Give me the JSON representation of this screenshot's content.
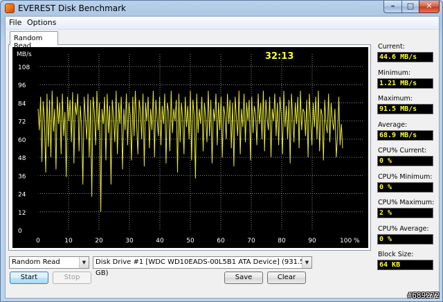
{
  "window": {
    "title": "EVEREST Disk Benchmark",
    "min_glyph": "–",
    "max_glyph": "□",
    "close_glyph": "✕"
  },
  "menu": {
    "items": [
      "File",
      "Options"
    ]
  },
  "tabs": [
    {
      "label": "Random Read",
      "active": true
    }
  ],
  "chart_data": {
    "type": "line",
    "ylabel": "MB/s",
    "xlabel": "",
    "timer": "32:13",
    "y_ticks": [
      "0",
      "12",
      "24",
      "36",
      "48",
      "60",
      "72",
      "84",
      "96",
      "108"
    ],
    "x_ticks": [
      "0",
      "10",
      "20",
      "30",
      "40",
      "50",
      "60",
      "70",
      "80",
      "90",
      "100 %"
    ],
    "xlim": [
      0,
      100
    ],
    "ylim": [
      0,
      120
    ],
    "grid": true,
    "series": [
      {
        "color": "#e8e83a",
        "values": [
          80,
          66,
          88,
          45,
          85,
          72,
          38,
          90,
          55,
          86,
          48,
          92,
          65,
          80,
          40,
          88,
          70,
          84,
          50,
          90,
          62,
          78,
          35,
          88,
          72,
          86,
          58,
          91,
          44,
          84,
          76,
          90,
          52,
          82,
          68,
          30,
          88,
          74,
          60,
          90,
          48,
          86,
          22,
          88,
          78,
          56,
          92,
          66,
          84,
          12,
          80,
          70,
          88,
          46,
          90,
          64,
          82,
          30,
          86,
          74,
          58,
          92,
          50,
          84,
          70,
          88,
          40,
          80,
          66,
          90,
          56,
          84,
          76,
          46,
          88,
          62,
          92,
          70,
          50,
          86,
          78,
          60,
          90,
          42,
          84,
          72,
          88,
          54,
          80,
          66,
          92,
          48,
          86,
          74,
          62,
          88,
          56,
          82,
          70,
          90,
          44,
          84,
          78,
          52,
          92,
          64,
          80,
          72,
          86,
          38,
          90,
          58,
          84,
          74,
          50,
          88,
          68,
          82,
          60,
          92,
          46,
          86,
          76,
          34,
          90,
          64,
          80,
          70,
          88,
          52,
          84,
          74,
          58,
          92,
          62,
          86,
          44,
          80,
          72,
          90,
          56,
          84,
          66,
          88,
          48,
          82,
          76,
          60,
          90,
          70,
          86,
          54,
          84,
          42,
          88,
          74,
          62,
          92,
          50,
          80,
          68,
          90,
          58,
          84,
          72,
          86,
          46,
          88,
          64,
          82,
          76,
          56,
          90,
          70,
          84,
          60,
          92,
          52,
          86,
          74,
          66,
          88,
          48,
          80,
          72,
          90,
          62,
          84,
          56,
          88,
          76,
          50,
          92,
          68,
          82,
          60,
          86,
          44,
          90,
          74,
          58,
          84,
          70,
          88,
          54,
          92,
          66,
          80,
          78,
          62,
          86,
          48,
          90,
          72,
          56,
          84,
          68,
          88,
          60,
          92,
          52,
          80,
          76,
          46,
          86,
          70,
          64,
          90,
          58,
          84,
          72,
          66,
          80,
          48,
          62,
          88,
          56,
          70,
          54
        ]
      }
    ]
  },
  "stats": [
    {
      "label": "Current:",
      "value": "44.6 MB/s"
    },
    {
      "label": "Minimum:",
      "value": "1.21 MB/s"
    },
    {
      "label": "Maximum:",
      "value": "91.5 MB/s"
    },
    {
      "label": "Average:",
      "value": "68.9 MB/s"
    },
    {
      "label": "CPU% Current:",
      "value": "0 %"
    },
    {
      "label": "CPU% Minimum:",
      "value": "0 %"
    },
    {
      "label": "CPU% Maximum:",
      "value": "2 %"
    },
    {
      "label": "CPU% Average:",
      "value": "0 %"
    },
    {
      "label": "Block Size:",
      "value": "64 KB"
    }
  ],
  "controls": {
    "test_select": "Random Read",
    "drive_select": "Disk Drive #1  [WDC WD10EADS-00L5B1 ATA Device]  (931.5 GB)",
    "start_label": "Start",
    "stop_label": "Stop",
    "save_label": "Save",
    "clear_label": "Clear",
    "dropdown_glyph": "▼"
  },
  "watermark": "#689272"
}
